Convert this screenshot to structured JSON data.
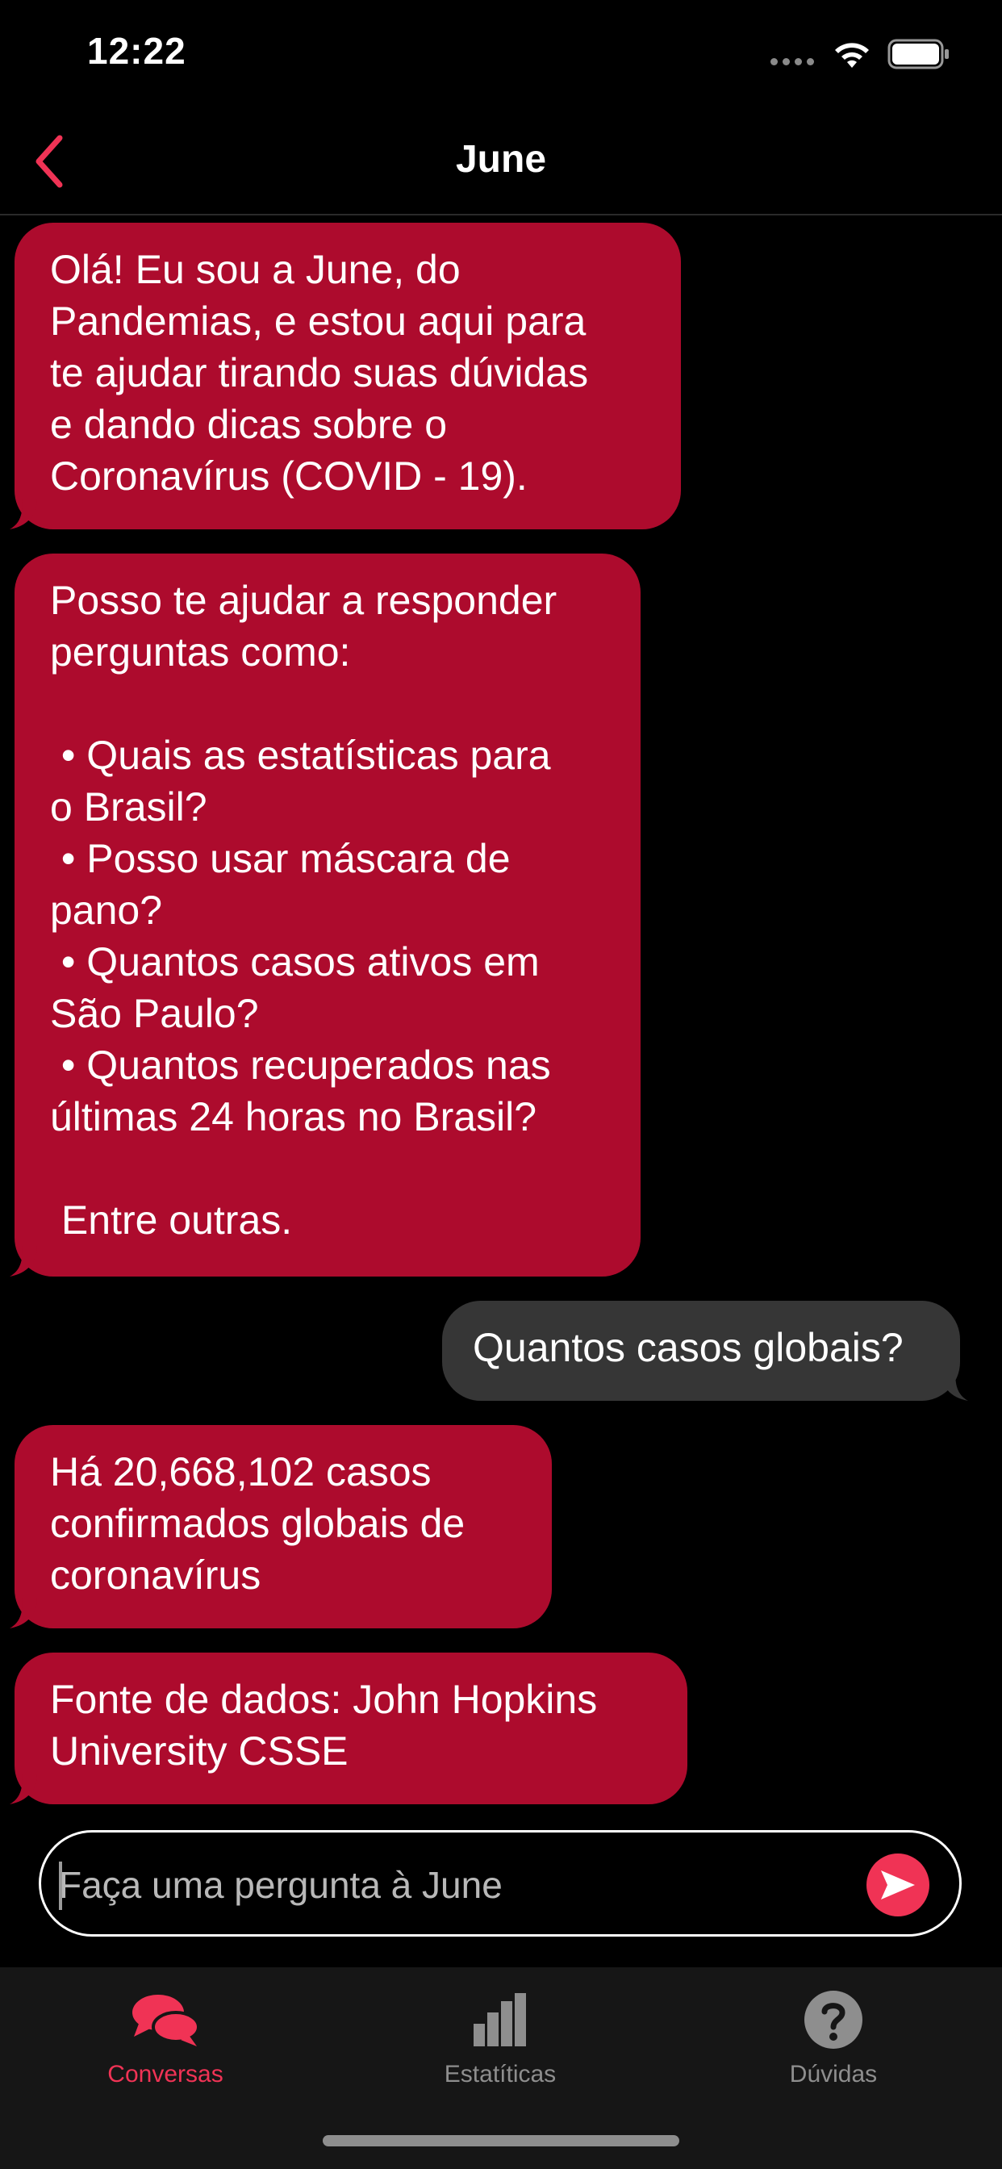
{
  "status_bar": {
    "time": "12:22"
  },
  "nav": {
    "title": "June",
    "back_icon": "chevron-left-icon"
  },
  "messages": [
    {
      "sender": "bot",
      "text": "Olá! Eu sou a June, do\nPandemias, e estou aqui para\nte ajudar tirando suas dúvidas\ne dando dicas sobre o\nCoronavírus (COVID - 19)."
    },
    {
      "sender": "bot",
      "text": "Posso te ajudar a responder\nperguntas como:\n\n • Quais as estatísticas para\no Brasil?\n • Posso usar máscara de\npano?\n • Quantos casos ativos em\nSão Paulo?\n • Quantos recuperados nas\núltimas 24 horas no Brasil?\n\n Entre outras."
    },
    {
      "sender": "user",
      "text": "Quantos casos globais?"
    },
    {
      "sender": "bot",
      "text": "Há 20,668,102 casos\nconfirmados globais de\ncoronavírus"
    },
    {
      "sender": "bot",
      "text": "Fonte de dados: John Hopkins\nUniversity CSSE"
    }
  ],
  "input": {
    "placeholder": "Faça uma pergunta à June",
    "value": ""
  },
  "tabs": [
    {
      "label": "Conversas",
      "icon": "chat-bubbles-icon",
      "active": true
    },
    {
      "label": "Estatíticas",
      "icon": "bar-chart-icon",
      "active": false
    },
    {
      "label": "Dúvidas",
      "icon": "question-circle-icon",
      "active": false
    }
  ],
  "colors": {
    "background": "#000000",
    "bot_bubble": "#ad0b2d",
    "user_bubble": "#363636",
    "accent": "#f03355",
    "tab_bar": "#161616",
    "tab_inactive": "#8e8e8e"
  }
}
